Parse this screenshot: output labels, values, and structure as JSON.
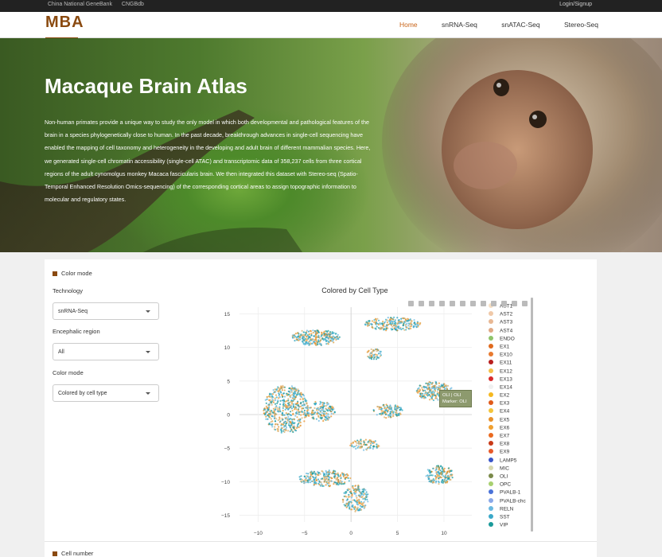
{
  "topbar": {
    "links": [
      "China National GeneBank",
      "CNGBdb"
    ],
    "login": "Login/Signup"
  },
  "nav": {
    "logo": "MBA",
    "logo_sub": "Macaque Brain Atlas",
    "items": [
      "Home",
      "snRNA-Seq",
      "snATAC-Seq",
      "Stereo-Seq"
    ],
    "active": "Home"
  },
  "hero": {
    "title": "Macaque Brain Atlas",
    "text": "Non-human primates provide a unique way to study the only model in which both developmental and pathological features of the brain in a species phylogenetically close to human. In the past decade, breakthrough advances in single-cell sequencing have enabled the mapping of cell taxonomy and heterogeneity in the developing and adult brain of different mammalian species. Here, we generated single-cell chromatin accessibility (single-cell ATAC) and transcriptomic data of 358,237 cells from three cortical regions of the adult cynomolgus monkey Macaca fascicularis brain. We then integrated this dataset with Stereo-seq (Spatio-Temporal Enhanced Resolution Omics-sequencing) of the corresponding cortical areas to assign topographic information to molecular and regulatory states."
  },
  "controls": {
    "section_title": "Color mode",
    "technology_label": "Technology",
    "technology_value": "snRNA-Seq",
    "region_label": "Encephalic region",
    "region_value": "All",
    "colormode_label": "Color mode",
    "colormode_value": "Colored by cell type"
  },
  "next_section": "Cell number",
  "tooltip": {
    "line1": "OLI | OLI",
    "line2": "Marker: OLI"
  },
  "legend": [
    {
      "name": "AST1",
      "color": "#f7e0c4"
    },
    {
      "name": "AST2",
      "color": "#f0c9a8"
    },
    {
      "name": "AST3",
      "color": "#e8b894"
    },
    {
      "name": "AST4",
      "color": "#e0a884"
    },
    {
      "name": "ENDO",
      "color": "#8fc46a"
    },
    {
      "name": "EX1",
      "color": "#e06a1e"
    },
    {
      "name": "EX10",
      "color": "#e87a30"
    },
    {
      "name": "EX11",
      "color": "#b81e1e"
    },
    {
      "name": "EX12",
      "color": "#f4c04a"
    },
    {
      "name": "EX13",
      "color": "#d82a2a"
    },
    {
      "name": "EX14",
      "color": "#f0f0f0"
    },
    {
      "name": "EX2",
      "color": "#f5b820"
    },
    {
      "name": "EX3",
      "color": "#e05a1a"
    },
    {
      "name": "EX4",
      "color": "#f3c43a"
    },
    {
      "name": "EX5",
      "color": "#e8902a"
    },
    {
      "name": "EX6",
      "color": "#f0a030"
    },
    {
      "name": "EX7",
      "color": "#ea6a20"
    },
    {
      "name": "EX8",
      "color": "#c83a18"
    },
    {
      "name": "EX9",
      "color": "#e85a2a"
    },
    {
      "name": "LAMP5",
      "color": "#3a56c8"
    },
    {
      "name": "MIC",
      "color": "#d8d8b0"
    },
    {
      "name": "OLI",
      "color": "#7a8a4a"
    },
    {
      "name": "OPC",
      "color": "#a8d070"
    },
    {
      "name": "PVALB-1",
      "color": "#4a72d8"
    },
    {
      "name": "PVALB-chc",
      "color": "#8aa8e8"
    },
    {
      "name": "RELN",
      "color": "#6ab8e0"
    },
    {
      "name": "SST",
      "color": "#3aa8c8"
    },
    {
      "name": "VIP",
      "color": "#1a9a9a"
    }
  ],
  "chart_data": {
    "type": "scatter",
    "title": "Colored by Cell Type",
    "xlabel": "",
    "ylabel": "",
    "xlim": [
      -12,
      13
    ],
    "ylim": [
      -16,
      16
    ],
    "xticks": [
      -10,
      -5,
      0,
      5,
      10
    ],
    "yticks": [
      15,
      10,
      5,
      0,
      -5,
      -10,
      -15
    ],
    "clusters": [
      {
        "name": "cluster-top-left",
        "x": -3.8,
        "y": 11.5,
        "rx": 2.6,
        "ry": 1.2,
        "n": 260
      },
      {
        "name": "cluster-top-right",
        "x": 4.5,
        "y": 13.5,
        "rx": 3.0,
        "ry": 1.0,
        "n": 220
      },
      {
        "name": "cluster-left-big",
        "x": -7.0,
        "y": 0.8,
        "rx": 2.4,
        "ry": 3.6,
        "n": 520
      },
      {
        "name": "cluster-left-mid",
        "x": -3.3,
        "y": 0.5,
        "rx": 1.6,
        "ry": 1.5,
        "n": 150
      },
      {
        "name": "cluster-lower-left",
        "x": -2.8,
        "y": -9.5,
        "rx": 2.8,
        "ry": 1.2,
        "n": 240
      },
      {
        "name": "cluster-bottom",
        "x": 0.5,
        "y": -12.5,
        "rx": 1.4,
        "ry": 2.0,
        "n": 180
      },
      {
        "name": "cluster-center-right",
        "x": 4.0,
        "y": 0.5,
        "rx": 1.6,
        "ry": 1.0,
        "n": 120
      },
      {
        "name": "cluster-right",
        "x": 9.0,
        "y": 3.5,
        "rx": 2.0,
        "ry": 1.4,
        "n": 220
      },
      {
        "name": "cluster-right-low",
        "x": 9.5,
        "y": -9.0,
        "rx": 1.5,
        "ry": 1.4,
        "n": 160
      },
      {
        "name": "cluster-mid-low",
        "x": 1.5,
        "y": -4.5,
        "rx": 1.6,
        "ry": 0.8,
        "n": 80
      },
      {
        "name": "cluster-mid-small",
        "x": 2.5,
        "y": 9.0,
        "rx": 0.8,
        "ry": 0.8,
        "n": 50
      }
    ]
  }
}
